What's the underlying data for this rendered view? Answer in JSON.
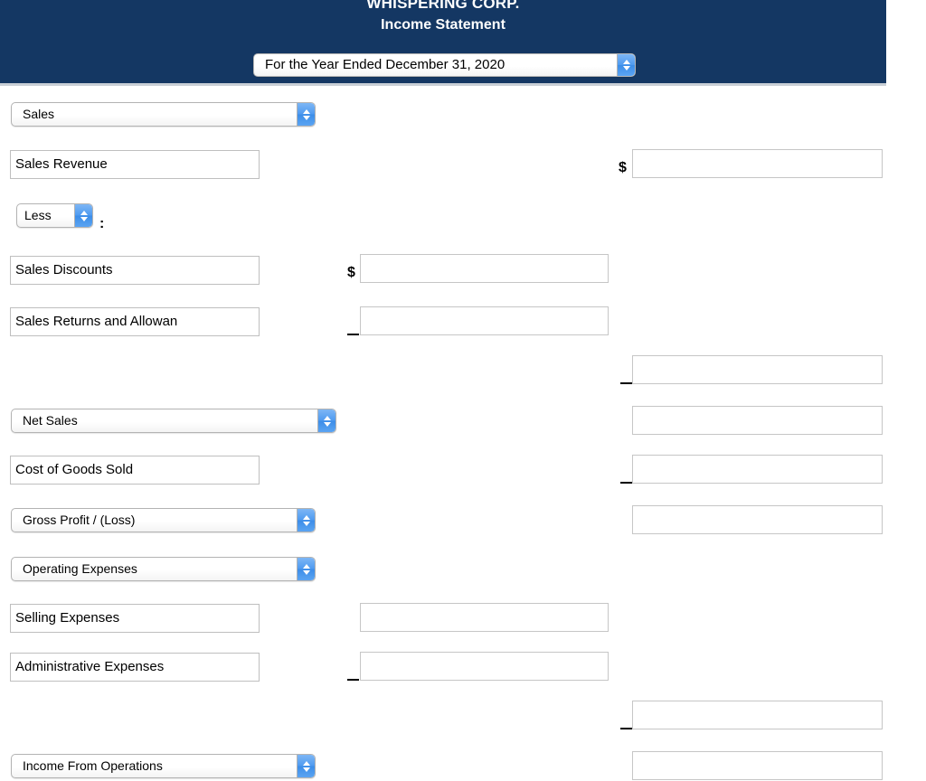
{
  "header": {
    "company_name": "WHISPERING CORP.",
    "statement_title": "Income Statement",
    "period_select": {
      "value": "For the Year Ended December 31, 2020",
      "icon": "stepper-updown-icon"
    },
    "band_color": "#143763"
  },
  "symbols": {
    "dollar": "$",
    "colon": ":"
  },
  "rows": [
    {
      "key": "sales_section",
      "type": "select",
      "label": "Sales"
    },
    {
      "key": "sales_revenue",
      "type": "text",
      "label": "Sales Revenue",
      "amount_value": ""
    },
    {
      "key": "less",
      "type": "select_small",
      "label": "Less"
    },
    {
      "key": "sales_discounts",
      "type": "text",
      "label": "Sales Discounts",
      "amount_value": ""
    },
    {
      "key": "sales_returns",
      "type": "text",
      "label": "Sales Returns and Allowan",
      "amount_value": ""
    },
    {
      "key": "deductions_subtotal",
      "type": "amount_only",
      "label": "",
      "amount_value": ""
    },
    {
      "key": "net_sales",
      "type": "select",
      "label": "Net Sales",
      "amount_value": ""
    },
    {
      "key": "cost_of_goods_sold",
      "type": "text",
      "label": "Cost of Goods Sold",
      "amount_value": ""
    },
    {
      "key": "gross_profit",
      "type": "select",
      "label": "Gross Profit / (Loss)",
      "amount_value": ""
    },
    {
      "key": "operating_expenses",
      "type": "select",
      "label": "Operating Expenses"
    },
    {
      "key": "selling_expenses",
      "type": "text",
      "label": "Selling Expenses",
      "amount_value": ""
    },
    {
      "key": "administrative_expenses",
      "type": "text",
      "label": "Administrative Expenses",
      "amount_value": ""
    },
    {
      "key": "total_operating_expenses",
      "type": "amount_only",
      "label": "",
      "amount_value": ""
    },
    {
      "key": "income_from_operations",
      "type": "select",
      "label": "Income From Operations",
      "amount_value": ""
    }
  ]
}
